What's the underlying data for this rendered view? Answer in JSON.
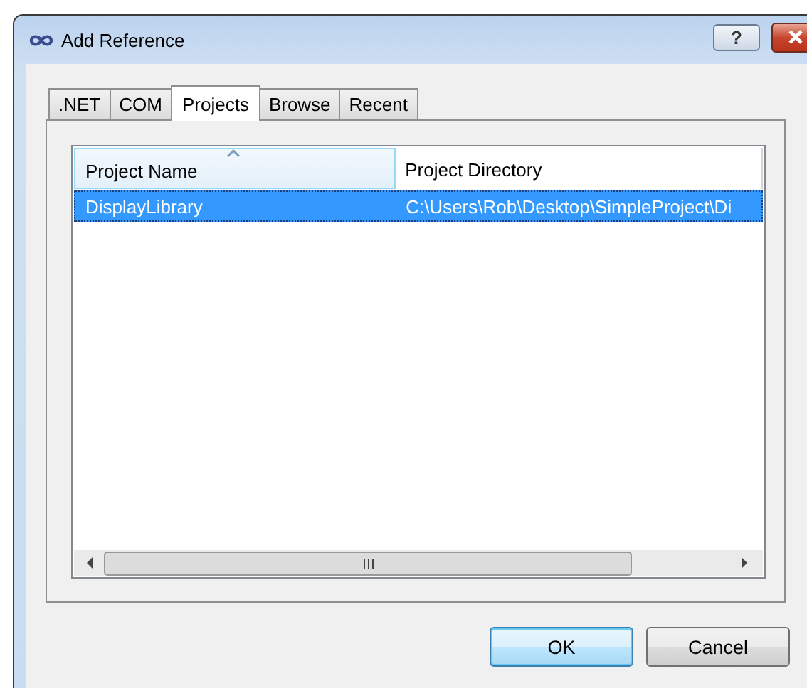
{
  "window": {
    "title": "Add Reference",
    "help_button": "?"
  },
  "tabs": [
    {
      "label": ".NET",
      "selected": false
    },
    {
      "label": "COM",
      "selected": false
    },
    {
      "label": "Projects",
      "selected": true
    },
    {
      "label": "Browse",
      "selected": false
    },
    {
      "label": "Recent",
      "selected": false
    }
  ],
  "table": {
    "columns": [
      {
        "label": "Project Name",
        "sorted": true
      },
      {
        "label": "Project Directory",
        "sorted": false
      }
    ],
    "rows": [
      {
        "cells": [
          "DisplayLibrary",
          "C:\\Users\\Rob\\Desktop\\SimpleProject\\Di"
        ],
        "selected": true
      }
    ]
  },
  "buttons": [
    {
      "label": "OK",
      "default": true
    },
    {
      "label": "Cancel",
      "default": false
    }
  ]
}
